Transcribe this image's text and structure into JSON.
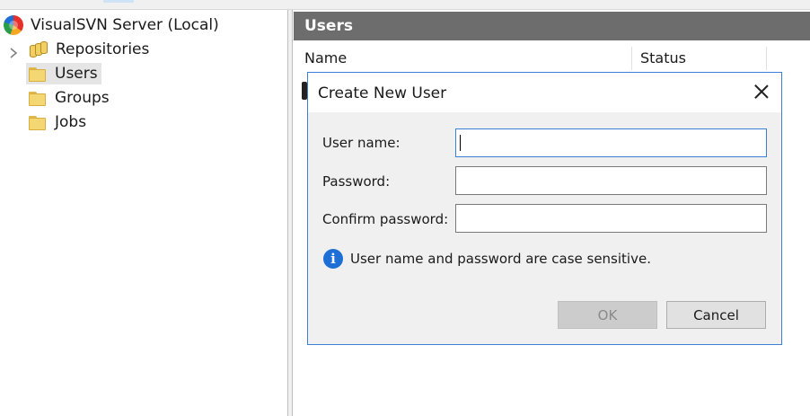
{
  "tree": {
    "root_label": "VisualSVN Server (Local)",
    "items": [
      {
        "label": "Repositories",
        "icon": "repository-icon"
      },
      {
        "label": "Users",
        "icon": "folder-icon",
        "selected": true
      },
      {
        "label": "Groups",
        "icon": "folder-icon"
      },
      {
        "label": "Jobs",
        "icon": "folder-icon"
      }
    ]
  },
  "right_pane": {
    "header": "Users",
    "columns": [
      "Name",
      "Status"
    ]
  },
  "dialog": {
    "title": "Create New User",
    "fields": [
      {
        "label": "User name:",
        "value": "",
        "focused": true
      },
      {
        "label": "Password:",
        "value": ""
      },
      {
        "label": "Confirm password:",
        "value": ""
      }
    ],
    "info_text": "User name and password are case sensitive.",
    "ok_label": "OK",
    "ok_enabled": false,
    "cancel_label": "Cancel"
  },
  "colors": {
    "header_bg": "#6d6d6d",
    "dialog_border": "#3c7fd6",
    "info_blue": "#1d6fd6",
    "selection_bg": "#e5e5e5"
  }
}
